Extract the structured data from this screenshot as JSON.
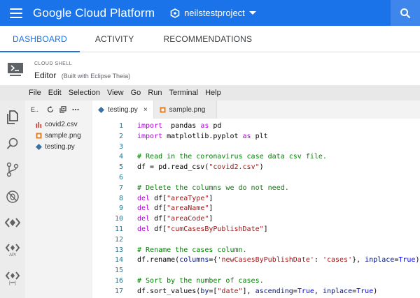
{
  "header": {
    "brand": "Google Cloud Platform",
    "project": "neilstestproject"
  },
  "nav_tabs": [
    {
      "label": "DASHBOARD",
      "active": true
    },
    {
      "label": "ACTIVITY",
      "active": false
    },
    {
      "label": "RECOMMENDATIONS",
      "active": false
    }
  ],
  "shell": {
    "caption": "CLOUD SHELL",
    "title": "Editor",
    "subtitle": "(Built with Eclipse Theia)"
  },
  "menu": [
    "File",
    "Edit",
    "Selection",
    "View",
    "Go",
    "Run",
    "Terminal",
    "Help"
  ],
  "activity": {
    "api_label": "API",
    "bracket_label": "[•••]"
  },
  "explorer": {
    "label": "E..",
    "files": [
      "covid2.csv",
      "sample.png",
      "testing.py"
    ]
  },
  "editor_tabs": [
    {
      "label": "testing.py",
      "close": "×",
      "active": true
    },
    {
      "label": "sample.png",
      "active": false
    }
  ],
  "code_lines": [
    {
      "n": "1",
      "tokens": [
        [
          "kw",
          "import"
        ],
        [
          "",
          "  pandas "
        ],
        [
          "kw",
          "as"
        ],
        [
          "",
          " pd"
        ]
      ]
    },
    {
      "n": "2",
      "tokens": [
        [
          "kw",
          "import"
        ],
        [
          "",
          " matplotlib.pyplot "
        ],
        [
          "kw",
          "as"
        ],
        [
          "",
          " plt"
        ]
      ]
    },
    {
      "n": "3",
      "tokens": []
    },
    {
      "n": "4",
      "tokens": [
        [
          "com",
          "# Read in the coronavirus case data csv file."
        ]
      ]
    },
    {
      "n": "5",
      "tokens": [
        [
          "",
          "df = pd.read_csv("
        ],
        [
          "str",
          "\"covid2.csv\""
        ],
        [
          "",
          ")"
        ]
      ]
    },
    {
      "n": "6",
      "tokens": []
    },
    {
      "n": "7",
      "tokens": [
        [
          "com",
          "# Delete the columns we do not need."
        ]
      ]
    },
    {
      "n": "8",
      "tokens": [
        [
          "kw",
          "del"
        ],
        [
          "",
          " df["
        ],
        [
          "str",
          "\"areaType\""
        ],
        [
          "",
          "]"
        ]
      ]
    },
    {
      "n": "9",
      "tokens": [
        [
          "kw",
          "del"
        ],
        [
          "",
          " df["
        ],
        [
          "str",
          "\"areaName\""
        ],
        [
          "",
          "]"
        ]
      ]
    },
    {
      "n": "10",
      "tokens": [
        [
          "kw",
          "del"
        ],
        [
          "",
          " df["
        ],
        [
          "str",
          "\"areaCode\""
        ],
        [
          "",
          "]"
        ]
      ]
    },
    {
      "n": "11",
      "tokens": [
        [
          "kw",
          "del"
        ],
        [
          "",
          " df["
        ],
        [
          "str",
          "\"cumCasesByPublishDate\""
        ],
        [
          "",
          "]"
        ]
      ]
    },
    {
      "n": "12",
      "tokens": []
    },
    {
      "n": "13",
      "tokens": [
        [
          "com",
          "# Rename the cases column."
        ]
      ]
    },
    {
      "n": "14",
      "tokens": [
        [
          "",
          "df.rename("
        ],
        [
          "param",
          "columns"
        ],
        [
          "",
          "={"
        ],
        [
          "str",
          "'newCasesByPublishDate'"
        ],
        [
          "",
          ": "
        ],
        [
          "str",
          "'cases'"
        ],
        [
          "",
          "}, "
        ],
        [
          "param",
          "inplace"
        ],
        [
          "",
          "="
        ],
        [
          "bool",
          "True"
        ],
        [
          "",
          ")"
        ]
      ]
    },
    {
      "n": "15",
      "tokens": []
    },
    {
      "n": "16",
      "tokens": [
        [
          "com",
          "# Sort by the number of cases."
        ]
      ]
    },
    {
      "n": "17",
      "tokens": [
        [
          "",
          "df.sort_values("
        ],
        [
          "param",
          "by"
        ],
        [
          "",
          "=["
        ],
        [
          "str",
          "\"date\""
        ],
        [
          "",
          "], "
        ],
        [
          "param",
          "ascending"
        ],
        [
          "",
          "="
        ],
        [
          "bool",
          "True"
        ],
        [
          "",
          ", "
        ],
        [
          "param",
          "inplace"
        ],
        [
          "",
          "="
        ],
        [
          "bool",
          "True"
        ],
        [
          "",
          ")"
        ]
      ]
    }
  ],
  "colors": {
    "header_blue": "#1a73e8",
    "keyword": "#af00db",
    "string": "#a31515",
    "comment": "#008000",
    "line_number": "#237893"
  }
}
